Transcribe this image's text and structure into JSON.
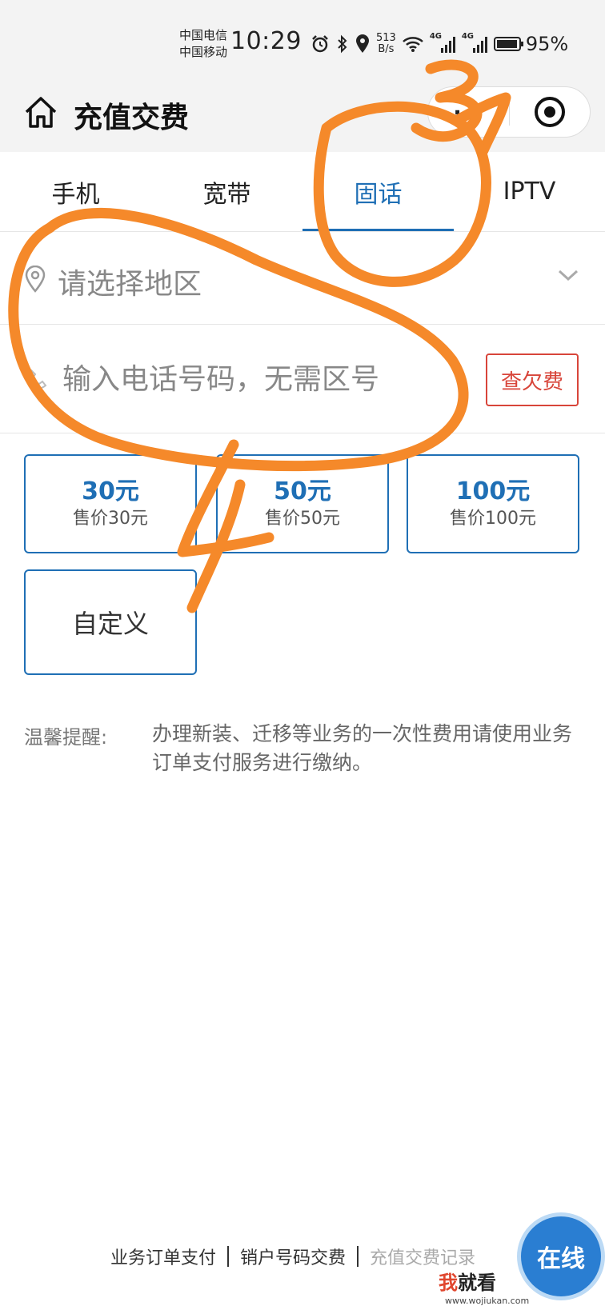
{
  "status_bar": {
    "carrier_1": "中国电信",
    "carrier_2": "中国移动",
    "time": "10:29",
    "net_speed_value": "513",
    "net_speed_unit": "B/s",
    "network_1": "4G",
    "network_2": "4G",
    "battery_percent": "95%",
    "battery_level": 0.95
  },
  "header": {
    "title": "充值交费",
    "more_label": "···"
  },
  "tabs": [
    {
      "label": "手机",
      "active": false
    },
    {
      "label": "宽带",
      "active": false
    },
    {
      "label": "固话",
      "active": true
    },
    {
      "label": "IPTV",
      "active": false
    }
  ],
  "region": {
    "placeholder": "请选择地区"
  },
  "phone": {
    "placeholder": "输入电话号码，无需区号",
    "query_button": "查欠费"
  },
  "amounts": [
    {
      "main": "30元",
      "sub": "售价30元"
    },
    {
      "main": "50元",
      "sub": "售价50元"
    },
    {
      "main": "100元",
      "sub": "售价100元"
    }
  ],
  "custom_amount": "自定义",
  "tip": {
    "label": "温馨提醒:",
    "text": "办理新装、迁移等业务的一次性费用请使用业务订单支付服务进行缴纳。"
  },
  "footer": {
    "link_1": "业务订单支付",
    "link_2": "销户号码交费",
    "link_3": "充值交费记录"
  },
  "online_service": "在线",
  "watermark": {
    "accent": "我",
    "rest": "就看",
    "url": "www.wojiukan.com"
  },
  "annotation": {
    "color": "#f5892a",
    "numbers": [
      "3",
      "4"
    ]
  }
}
